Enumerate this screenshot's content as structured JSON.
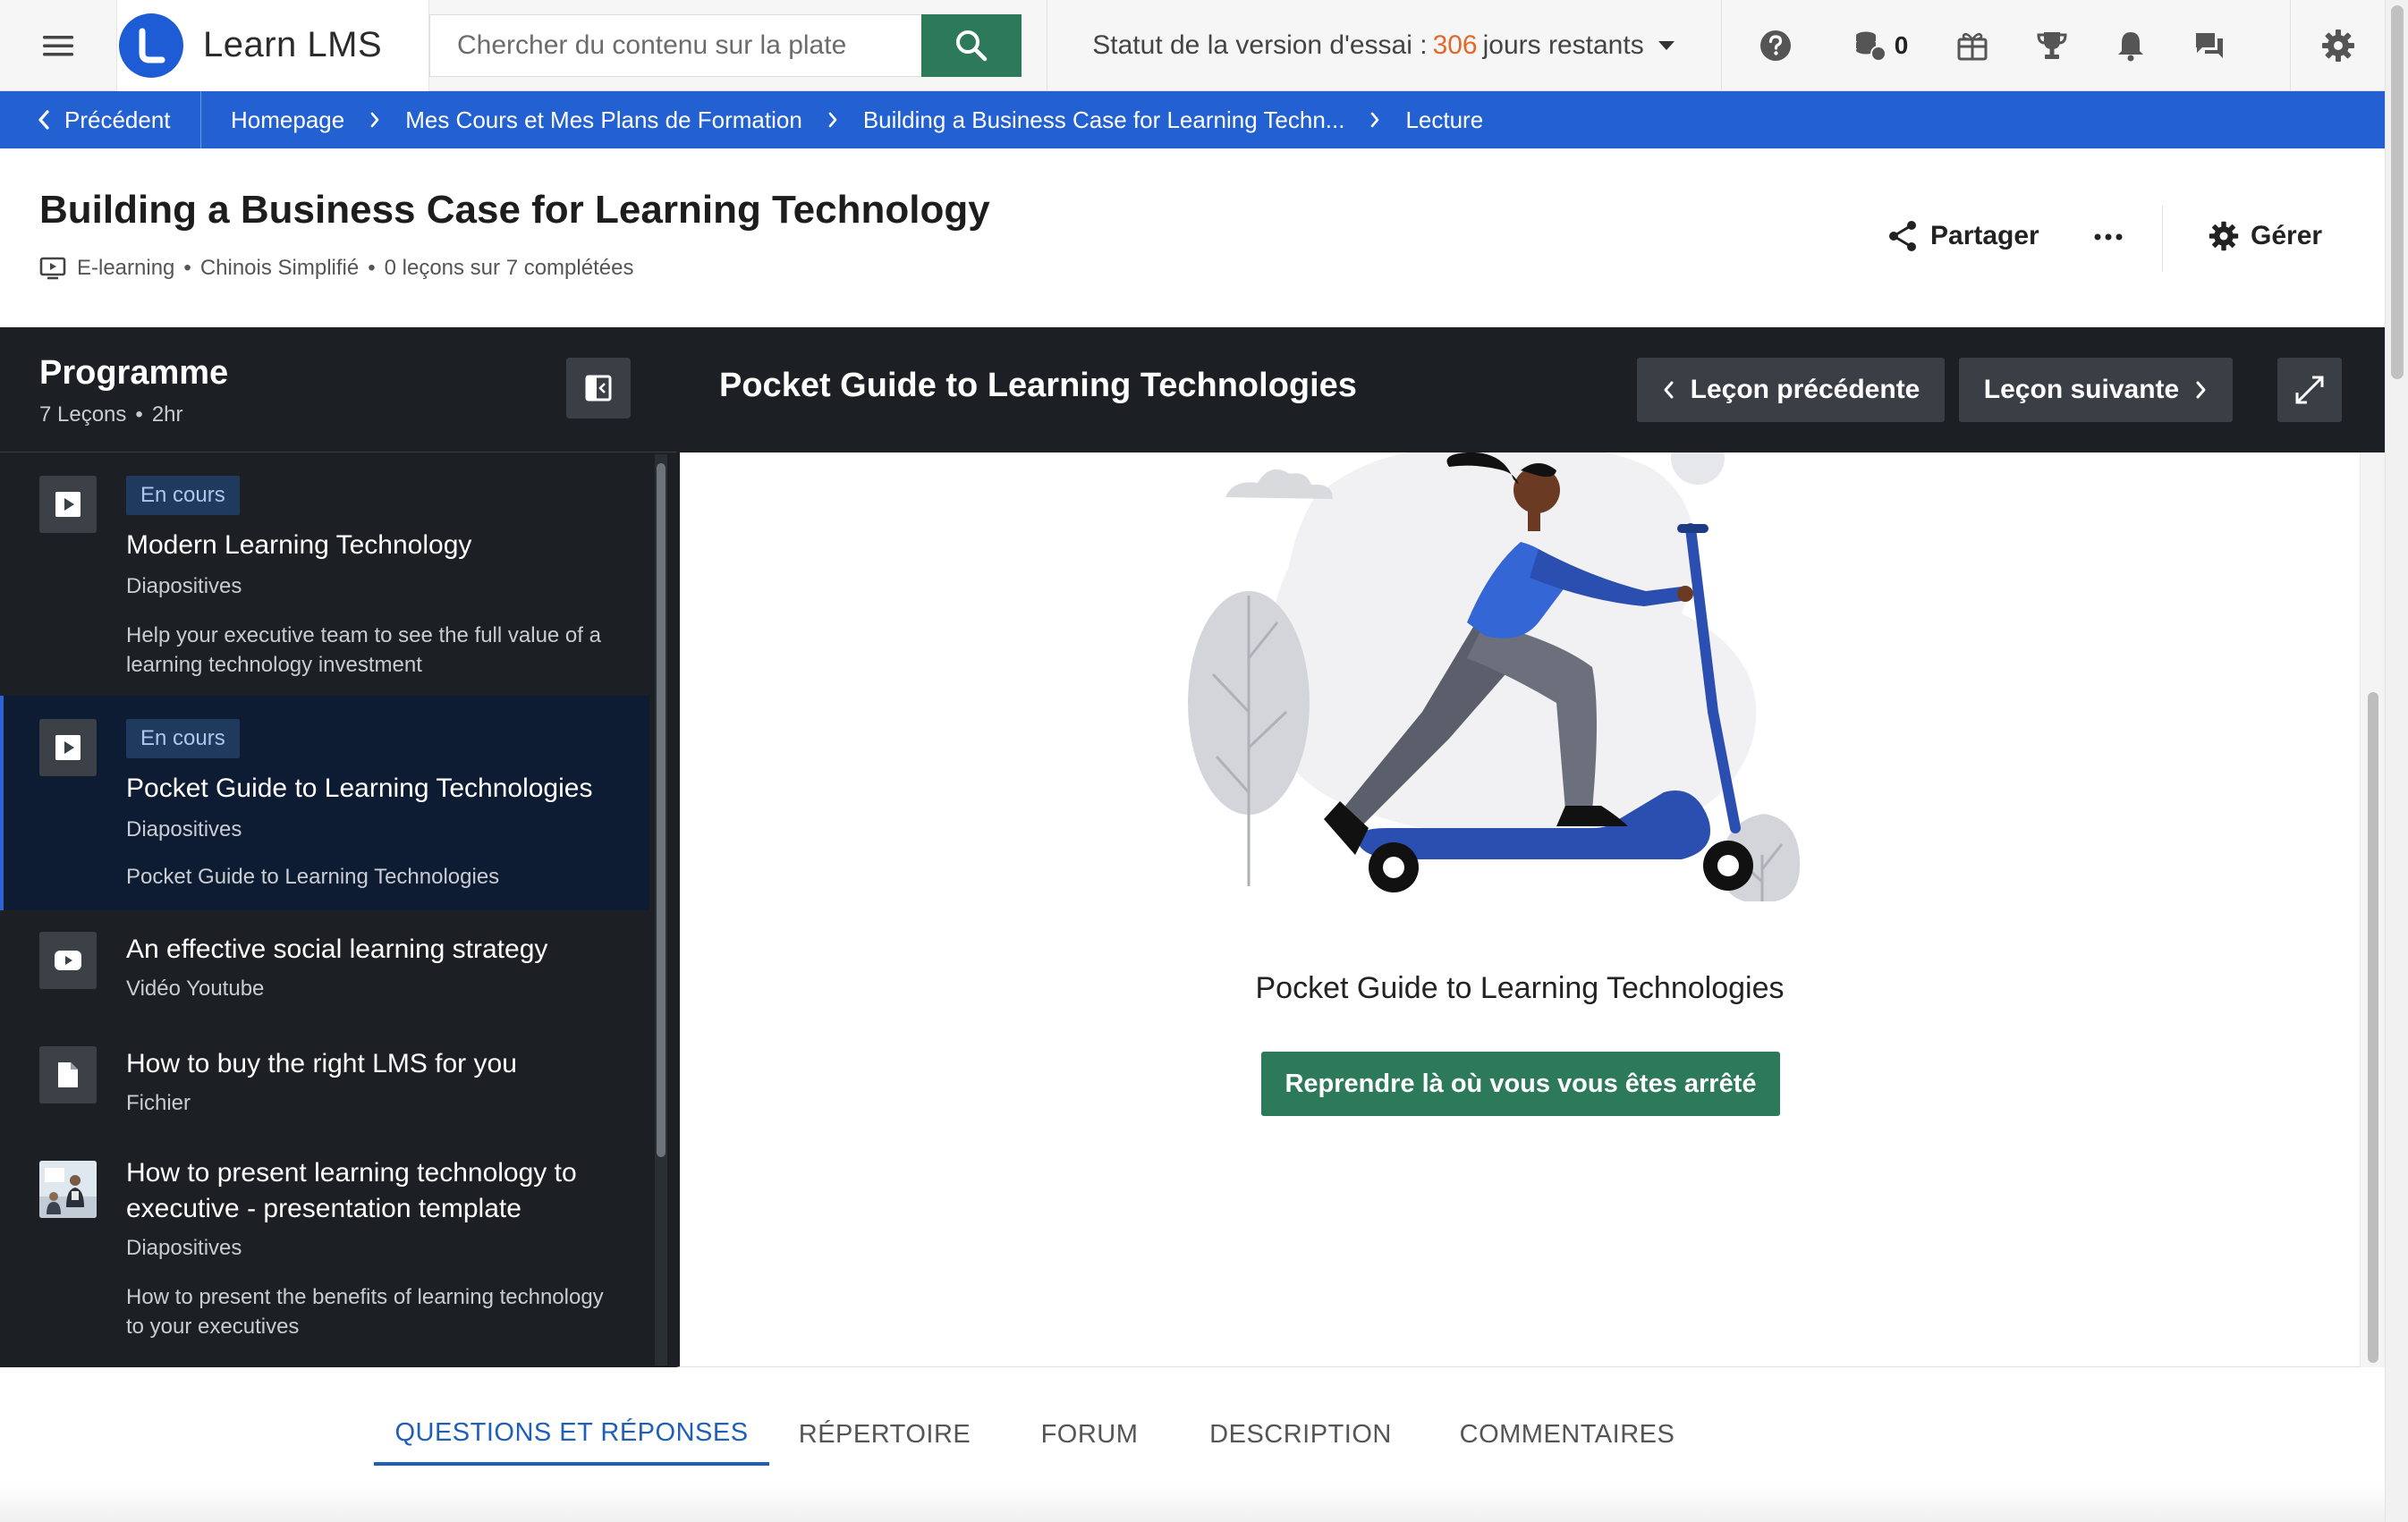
{
  "header": {
    "brand_name": "Learn LMS",
    "search_placeholder": "Chercher du contenu sur la plate",
    "trial_prefix": "Statut de la version d'essai :",
    "trial_days": "306",
    "trial_suffix": "jours restants",
    "coin_count": "0",
    "accent_color": "#2c7a59",
    "brand_color": "#1e5cd6"
  },
  "breadcrumb": {
    "back_label": "Précédent",
    "items": [
      "Homepage",
      "Mes Cours et Mes Plans de Formation",
      "Building a Business Case for Learning Techn...",
      "Lecture"
    ]
  },
  "course": {
    "title": "Building a Business Case for Learning Technology",
    "type": "E-learning",
    "language": "Chinois Simplifié",
    "progress": "0 leçons sur 7 complétées",
    "share_label": "Partager",
    "manage_label": "Gérer"
  },
  "sidebar": {
    "title": "Programme",
    "lesson_count": "7 Leçons",
    "duration": "2hr",
    "lessons": [
      {
        "icon": "play-icon",
        "badge": "En cours",
        "title": "Modern Learning Technology",
        "type": "Diapositives",
        "description": "Help your executive team to see the full value of a learning technology investment"
      },
      {
        "icon": "play-icon",
        "badge": "En cours",
        "title": "Pocket Guide to Learning Technologies",
        "type": "Diapositives",
        "description": "Pocket Guide to Learning Technologies"
      },
      {
        "icon": "youtube-icon",
        "title": "An effective social learning strategy",
        "type": "Vidéo Youtube"
      },
      {
        "icon": "file-icon",
        "title": "How to buy the right LMS for you",
        "type": "Fichier"
      },
      {
        "icon": "presentation-thumbnail",
        "title": "How to present learning technology to executive - presentation template",
        "type": "Diapositives",
        "description": "How to present the benefits of learning technology to your executives"
      }
    ]
  },
  "lesson": {
    "title": "Pocket Guide to Learning Technologies",
    "prev_label": "Leçon précédente",
    "next_label": "Leçon suivante",
    "content_title": "Pocket Guide to Learning Technologies",
    "resume_label": "Reprendre là où vous vous êtes arrêté"
  },
  "tabs": [
    "QUESTIONS ET RÉPONSES",
    "RÉPERTOIRE",
    "FORUM",
    "DESCRIPTION",
    "COMMENTAIRES"
  ]
}
